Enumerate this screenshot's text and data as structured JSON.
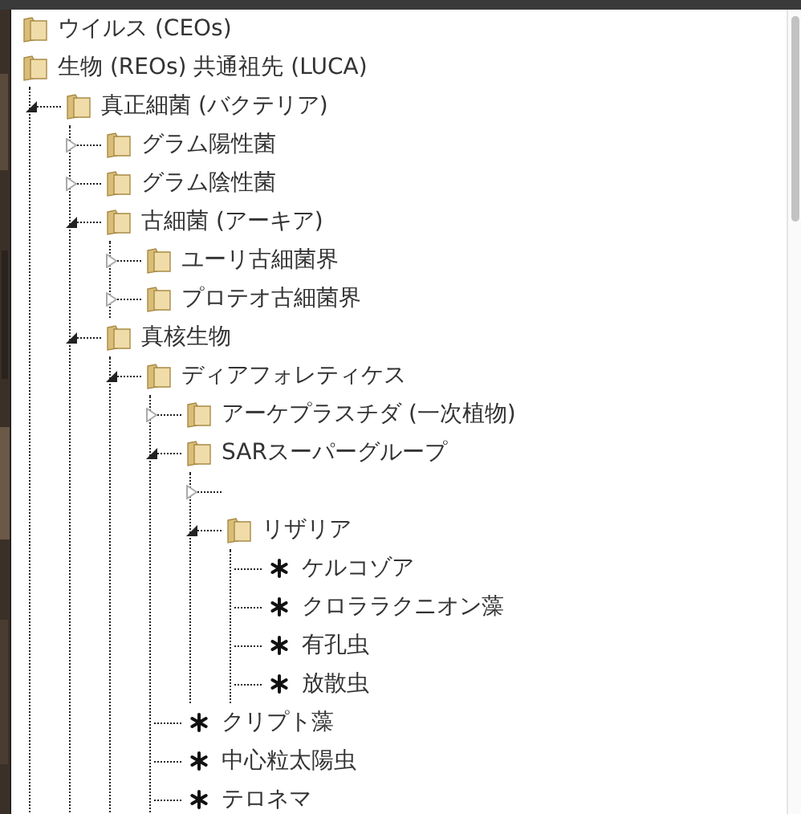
{
  "tree": [
    {
      "kind": "folder",
      "label": "ウイルス (CEOs)"
    },
    {
      "kind": "folder",
      "label": "生物 (REOs) 共通祖先 (LUCA)",
      "children": [
        {
          "kind": "folder",
          "label": "真正細菌 (バクテリア)",
          "expanded": true,
          "children": [
            {
              "kind": "folder",
              "label": "グラム陽性菌",
              "expanded": false
            },
            {
              "kind": "folder",
              "label": "グラム陰性菌",
              "expanded": false
            },
            {
              "kind": "folder",
              "label": "古細菌 (アーキア)",
              "expanded": true,
              "children": [
                {
                  "kind": "folder",
                  "label": "ユーリ古細菌界",
                  "expanded": false
                },
                {
                  "kind": "folder",
                  "label": "プロテオ古細菌界",
                  "expanded": false
                }
              ]
            },
            {
              "kind": "folder",
              "label": "真核生物",
              "expanded": true,
              "children": [
                {
                  "kind": "folder",
                  "label": "ディアフォレティケス",
                  "expanded": true,
                  "children": [
                    {
                      "kind": "folder",
                      "label": "アーケプラスチダ (一次植物)",
                      "expanded": false
                    },
                    {
                      "kind": "folder",
                      "label": "SARスーパーグループ",
                      "expanded": true,
                      "children": [
                        {
                          "kind": "empty",
                          "expanded": false
                        },
                        {
                          "kind": "folder",
                          "label": "リザリア",
                          "expanded": true,
                          "children": [
                            {
                              "kind": "leaf",
                              "label": "ケルコゾア"
                            },
                            {
                              "kind": "leaf",
                              "label": "クロララクニオン藻"
                            },
                            {
                              "kind": "leaf",
                              "label": "有孔虫"
                            },
                            {
                              "kind": "leaf",
                              "label": "放散虫"
                            }
                          ]
                        }
                      ]
                    },
                    {
                      "kind": "leaf",
                      "label": "クリプト藻"
                    },
                    {
                      "kind": "leaf",
                      "label": "中心粒太陽虫"
                    },
                    {
                      "kind": "leaf",
                      "label": "テロネマ"
                    }
                  ]
                }
              ]
            }
          ]
        }
      ]
    }
  ]
}
